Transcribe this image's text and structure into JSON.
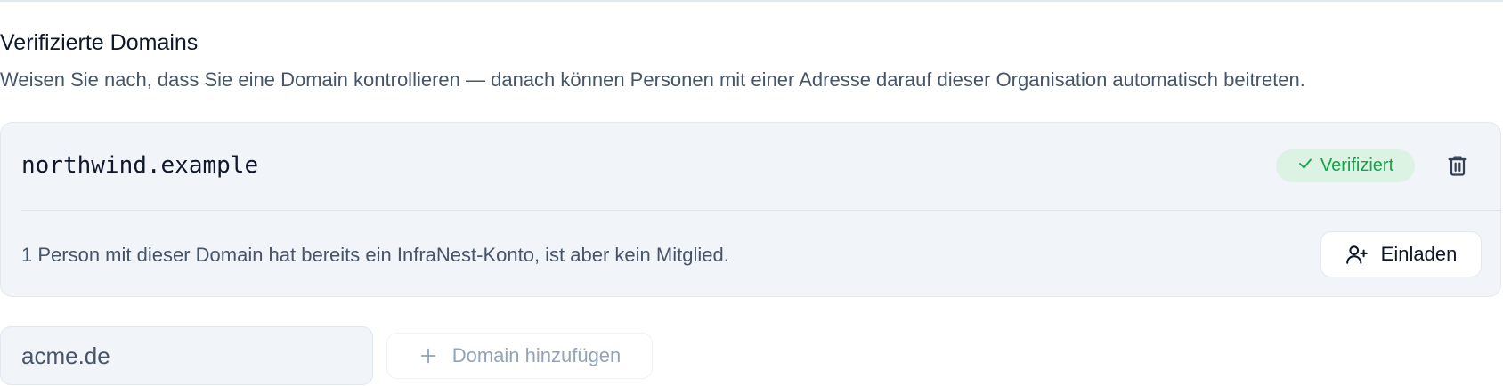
{
  "section": {
    "title": "Verifizierte Domains",
    "description": "Weisen Sie nach, dass Sie eine Domain kontrollieren — danach können Personen mit einer Adresse darauf dieser Organisation automatisch beitreten."
  },
  "domain_card": {
    "domain": "northwind.example",
    "status_label": "Verifiziert",
    "status_color": "#16a34a",
    "delete_icon": "trash-icon",
    "note": "1 Person mit dieser Domain hat bereits ein InfraNest-Konto, ist aber kein Mitglied.",
    "invite_label": "Einladen",
    "invite_icon": "user-plus-icon"
  },
  "add_domain": {
    "input_value": "acme.de",
    "button_label": "Domain hinzufügen",
    "button_icon": "plus-icon"
  }
}
